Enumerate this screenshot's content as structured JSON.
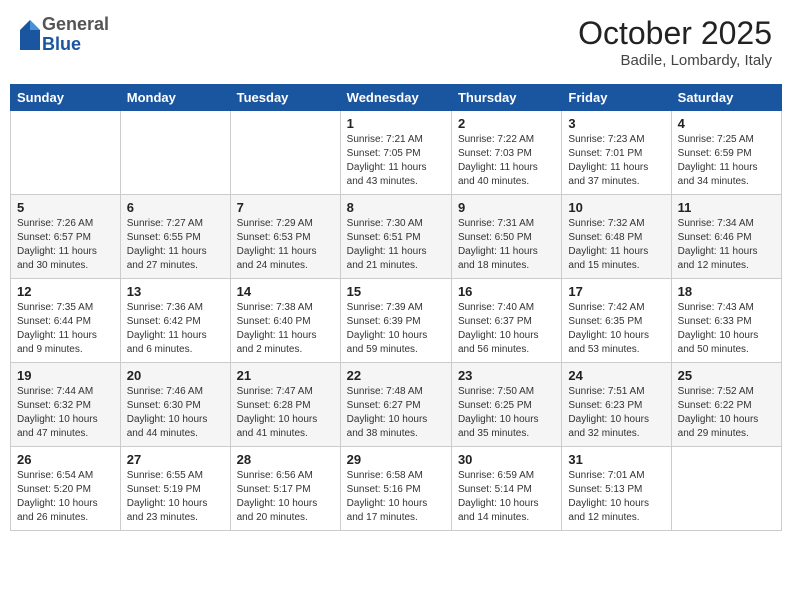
{
  "header": {
    "logo": {
      "general": "General",
      "blue": "Blue"
    },
    "title": "October 2025",
    "location": "Badile, Lombardy, Italy"
  },
  "days_of_week": [
    "Sunday",
    "Monday",
    "Tuesday",
    "Wednesday",
    "Thursday",
    "Friday",
    "Saturday"
  ],
  "weeks": [
    [
      null,
      null,
      null,
      {
        "day": "1",
        "sunrise": "7:21 AM",
        "sunset": "7:05 PM",
        "daylight": "11 hours and 43 minutes."
      },
      {
        "day": "2",
        "sunrise": "7:22 AM",
        "sunset": "7:03 PM",
        "daylight": "11 hours and 40 minutes."
      },
      {
        "day": "3",
        "sunrise": "7:23 AM",
        "sunset": "7:01 PM",
        "daylight": "11 hours and 37 minutes."
      },
      {
        "day": "4",
        "sunrise": "7:25 AM",
        "sunset": "6:59 PM",
        "daylight": "11 hours and 34 minutes."
      }
    ],
    [
      {
        "day": "5",
        "sunrise": "7:26 AM",
        "sunset": "6:57 PM",
        "daylight": "11 hours and 30 minutes."
      },
      {
        "day": "6",
        "sunrise": "7:27 AM",
        "sunset": "6:55 PM",
        "daylight": "11 hours and 27 minutes."
      },
      {
        "day": "7",
        "sunrise": "7:29 AM",
        "sunset": "6:53 PM",
        "daylight": "11 hours and 24 minutes."
      },
      {
        "day": "8",
        "sunrise": "7:30 AM",
        "sunset": "6:51 PM",
        "daylight": "11 hours and 21 minutes."
      },
      {
        "day": "9",
        "sunrise": "7:31 AM",
        "sunset": "6:50 PM",
        "daylight": "11 hours and 18 minutes."
      },
      {
        "day": "10",
        "sunrise": "7:32 AM",
        "sunset": "6:48 PM",
        "daylight": "11 hours and 15 minutes."
      },
      {
        "day": "11",
        "sunrise": "7:34 AM",
        "sunset": "6:46 PM",
        "daylight": "11 hours and 12 minutes."
      }
    ],
    [
      {
        "day": "12",
        "sunrise": "7:35 AM",
        "sunset": "6:44 PM",
        "daylight": "11 hours and 9 minutes."
      },
      {
        "day": "13",
        "sunrise": "7:36 AM",
        "sunset": "6:42 PM",
        "daylight": "11 hours and 6 minutes."
      },
      {
        "day": "14",
        "sunrise": "7:38 AM",
        "sunset": "6:40 PM",
        "daylight": "11 hours and 2 minutes."
      },
      {
        "day": "15",
        "sunrise": "7:39 AM",
        "sunset": "6:39 PM",
        "daylight": "10 hours and 59 minutes."
      },
      {
        "day": "16",
        "sunrise": "7:40 AM",
        "sunset": "6:37 PM",
        "daylight": "10 hours and 56 minutes."
      },
      {
        "day": "17",
        "sunrise": "7:42 AM",
        "sunset": "6:35 PM",
        "daylight": "10 hours and 53 minutes."
      },
      {
        "day": "18",
        "sunrise": "7:43 AM",
        "sunset": "6:33 PM",
        "daylight": "10 hours and 50 minutes."
      }
    ],
    [
      {
        "day": "19",
        "sunrise": "7:44 AM",
        "sunset": "6:32 PM",
        "daylight": "10 hours and 47 minutes."
      },
      {
        "day": "20",
        "sunrise": "7:46 AM",
        "sunset": "6:30 PM",
        "daylight": "10 hours and 44 minutes."
      },
      {
        "day": "21",
        "sunrise": "7:47 AM",
        "sunset": "6:28 PM",
        "daylight": "10 hours and 41 minutes."
      },
      {
        "day": "22",
        "sunrise": "7:48 AM",
        "sunset": "6:27 PM",
        "daylight": "10 hours and 38 minutes."
      },
      {
        "day": "23",
        "sunrise": "7:50 AM",
        "sunset": "6:25 PM",
        "daylight": "10 hours and 35 minutes."
      },
      {
        "day": "24",
        "sunrise": "7:51 AM",
        "sunset": "6:23 PM",
        "daylight": "10 hours and 32 minutes."
      },
      {
        "day": "25",
        "sunrise": "7:52 AM",
        "sunset": "6:22 PM",
        "daylight": "10 hours and 29 minutes."
      }
    ],
    [
      {
        "day": "26",
        "sunrise": "6:54 AM",
        "sunset": "5:20 PM",
        "daylight": "10 hours and 26 minutes."
      },
      {
        "day": "27",
        "sunrise": "6:55 AM",
        "sunset": "5:19 PM",
        "daylight": "10 hours and 23 minutes."
      },
      {
        "day": "28",
        "sunrise": "6:56 AM",
        "sunset": "5:17 PM",
        "daylight": "10 hours and 20 minutes."
      },
      {
        "day": "29",
        "sunrise": "6:58 AM",
        "sunset": "5:16 PM",
        "daylight": "10 hours and 17 minutes."
      },
      {
        "day": "30",
        "sunrise": "6:59 AM",
        "sunset": "5:14 PM",
        "daylight": "10 hours and 14 minutes."
      },
      {
        "day": "31",
        "sunrise": "7:01 AM",
        "sunset": "5:13 PM",
        "daylight": "10 hours and 12 minutes."
      },
      null
    ]
  ]
}
